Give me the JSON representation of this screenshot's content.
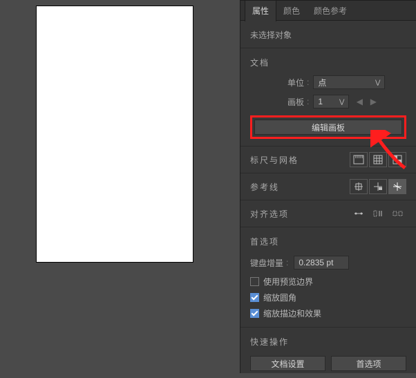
{
  "tabs": {
    "properties": "属性",
    "color": "颜色",
    "swatches": "颜色参考"
  },
  "noSelection": "未选择对象",
  "doc": {
    "title": "文档",
    "unit_label": "单位",
    "unit_value": "点",
    "artboard_label": "画板",
    "artboard_value": "1",
    "edit_artboard": "编辑画板"
  },
  "ruler_grid": {
    "label": "标尺与网格"
  },
  "guides": {
    "label": "参考线"
  },
  "align": {
    "label": "对齐选项"
  },
  "prefs": {
    "title": "首选项",
    "kb_label": "键盘增量",
    "kb_value": "0.2835 pt",
    "preview_bounds": "使用预览边界",
    "scale_corners": "缩放圆角",
    "scale_strokes": "缩放描边和效果"
  },
  "quick": {
    "title": "快速操作",
    "doc_setup": "文档设置",
    "pref_btn": "首选项"
  }
}
